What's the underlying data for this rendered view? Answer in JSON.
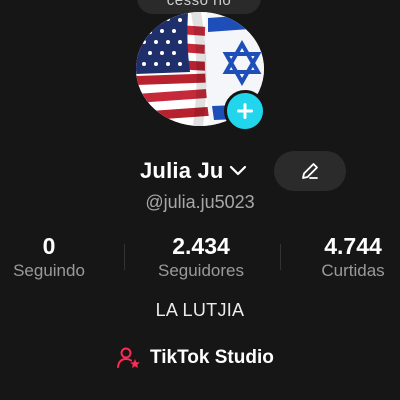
{
  "top_button": {
    "label": "cesso rio"
  },
  "profile": {
    "name": "Julia Ju",
    "handle": "@julia.ju5023",
    "bio": "LA LUTJIA"
  },
  "stats": {
    "following": {
      "value": "0",
      "label": "Seguindo"
    },
    "followers": {
      "value": "2.434",
      "label": "Seguidores"
    },
    "likes": {
      "value": "4.744",
      "label": "Curtidas"
    }
  },
  "studio": {
    "label": "TikTok Studio"
  },
  "icons": {
    "add": "plus-icon",
    "name_dropdown": "chevron-down-icon",
    "edit": "pencil-icon",
    "studio": "user-star-icon"
  },
  "colors": {
    "background": "#161616",
    "accent_cyan": "#20d5ec",
    "accent_red": "#fe2c55",
    "secondary_text": "#a8a8a8"
  }
}
